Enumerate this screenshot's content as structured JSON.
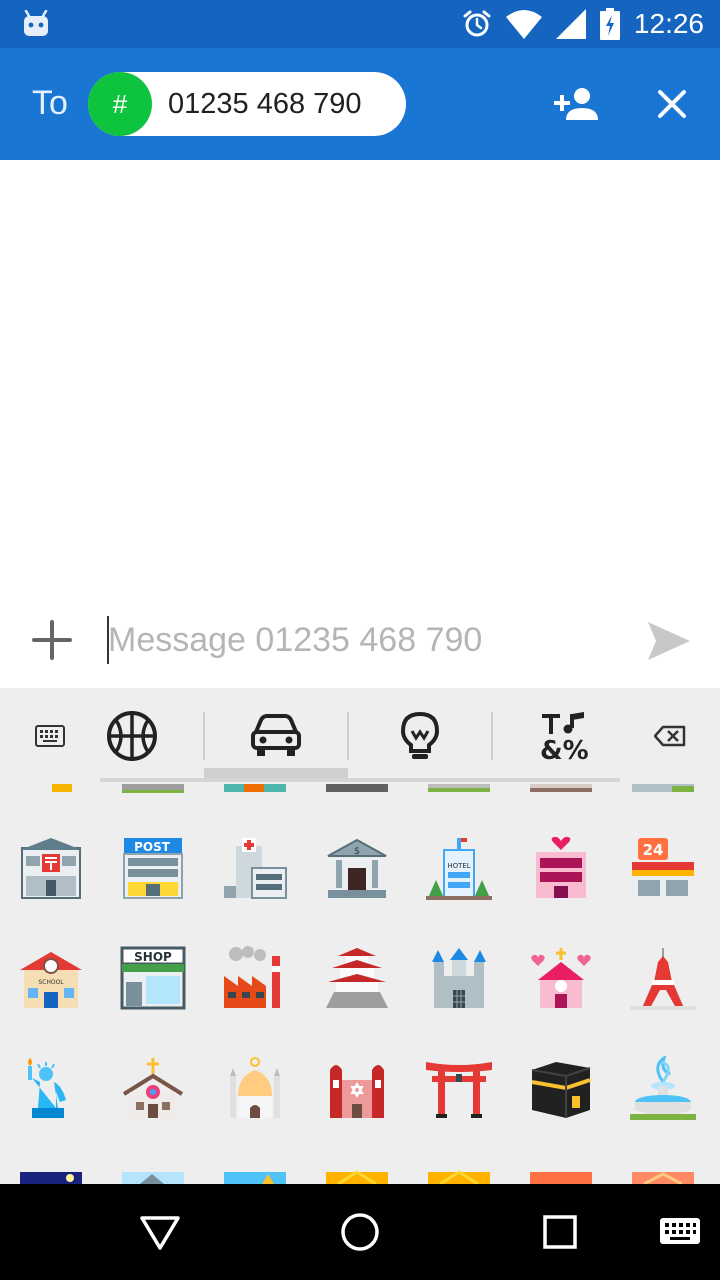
{
  "status_bar": {
    "time": "12:26",
    "icons": [
      "android-icon",
      "alarm-icon",
      "wifi-icon",
      "signal-icon",
      "battery-charging-icon"
    ]
  },
  "header": {
    "to_label": "To",
    "recipient": {
      "avatar_symbol": "#",
      "number": "01235 468 790"
    },
    "actions": [
      "add-person-icon",
      "close-icon"
    ]
  },
  "compose": {
    "placeholder": "Message 01235 468 790",
    "value": "",
    "actions": [
      "add-icon",
      "send-icon"
    ]
  },
  "keyboard": {
    "tabs": [
      {
        "name": "keyboard-toggle",
        "icon": "keyboard-icon"
      },
      {
        "name": "activity",
        "icon": "basketball-icon"
      },
      {
        "name": "travel-places",
        "icon": "car-icon",
        "selected": true
      },
      {
        "name": "objects",
        "icon": "lightbulb-icon"
      },
      {
        "name": "symbols",
        "icon": "symbols-icon",
        "label": "&%"
      },
      {
        "name": "delete",
        "icon": "backspace-icon"
      }
    ],
    "emoji_rows": [
      [
        "japanese-post-office",
        "post-office",
        "hospital",
        "bank",
        "hotel",
        "love-hotel",
        "convenience-store"
      ],
      [
        "school",
        "department-store",
        "factory",
        "japanese-castle",
        "european-castle",
        "wedding-chapel",
        "tokyo-tower"
      ],
      [
        "statue-of-liberty",
        "church",
        "mosque",
        "synagogue",
        "shinto-shrine",
        "kaaba",
        "fountain"
      ]
    ],
    "post_sign": "POST",
    "shop_sign": "SHOP",
    "school_sign": "SCHOOL",
    "hotel_sign": "HOTEL",
    "store_number": "24"
  },
  "nav_bar": {
    "buttons": [
      "back-icon",
      "home-icon",
      "recents-icon",
      "keyboard-switch-icon"
    ]
  },
  "colors": {
    "status_bar": "#1565c0",
    "app_bar": "#1976d2",
    "chip_avatar": "#0ec43f",
    "keyboard_bg": "#eeeeee",
    "nav_bar": "#000000"
  }
}
